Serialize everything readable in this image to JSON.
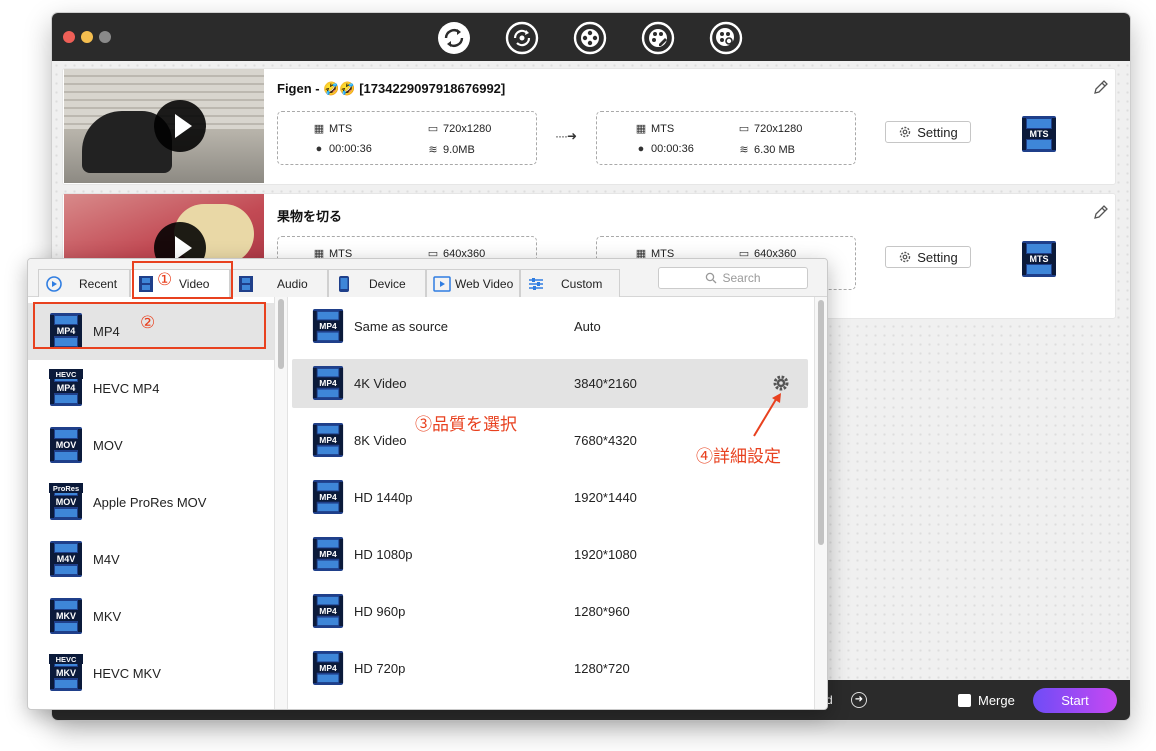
{
  "toolbar": {
    "icons": [
      "convert-icon",
      "reconvert-icon",
      "film-reel-icon",
      "film-edit-icon",
      "film-search-icon"
    ]
  },
  "files": [
    {
      "title": "Figen - 🤣🤣 [1734229097918676992]",
      "source": {
        "format": "MTS",
        "resolution": "720x1280",
        "duration": "00:00:36",
        "size": "9.0MB"
      },
      "output": {
        "format": "MTS",
        "resolution": "720x1280",
        "duration": "00:00:36",
        "size": "6.30 MB"
      },
      "setting_label": "Setting",
      "output_format_icon": "MTS"
    },
    {
      "title": "果物を切る",
      "source": {
        "format": "MTS",
        "resolution": "640x360"
      },
      "output": {
        "format": "MTS",
        "resolution": "640x360"
      },
      "setting_label": "Setting",
      "output_format_icon": "MTS"
    }
  ],
  "arrow": "····➜",
  "popup": {
    "tabs": [
      "Recent",
      "Video",
      "Audio",
      "Device",
      "Web Video",
      "Custom"
    ],
    "active_tab": "Video",
    "search_placeholder": "Search",
    "formats": [
      {
        "label": "MP4",
        "icon": "MP4",
        "selected": true
      },
      {
        "label": "HEVC MP4",
        "icon": "MP4",
        "badge": "HEVC"
      },
      {
        "label": "MOV",
        "icon": "MOV"
      },
      {
        "label": "Apple ProRes MOV",
        "icon": "MOV",
        "badge": "ProRes"
      },
      {
        "label": "M4V",
        "icon": "M4V"
      },
      {
        "label": "MKV",
        "icon": "MKV"
      },
      {
        "label": "HEVC MKV",
        "icon": "MKV",
        "badge": "HEVC"
      }
    ],
    "qualities": [
      {
        "label": "Same as source",
        "res": "Auto"
      },
      {
        "label": "4K Video",
        "res": "3840*2160",
        "selected": true
      },
      {
        "label": "8K Video",
        "res": "7680*4320"
      },
      {
        "label": "HD 1440p",
        "res": "1920*1440"
      },
      {
        "label": "HD 1080p",
        "res": "1920*1080"
      },
      {
        "label": "HD 960p",
        "res": "1280*960"
      },
      {
        "label": "HD 720p",
        "res": "1280*720"
      }
    ]
  },
  "annotations": {
    "step1": "①",
    "step2": "②",
    "step3": "③品質を選択",
    "step4": "④詳細設定"
  },
  "bottom": {
    "output_tail": "ted",
    "go_glyph": "➜",
    "merge_label": "Merge",
    "start_label": "Start"
  },
  "colors": {
    "accent_red": "#e8411f",
    "start_gradient": [
      "#6f4cf6",
      "#c748f2"
    ],
    "titlebar": "#2b2b2b"
  }
}
